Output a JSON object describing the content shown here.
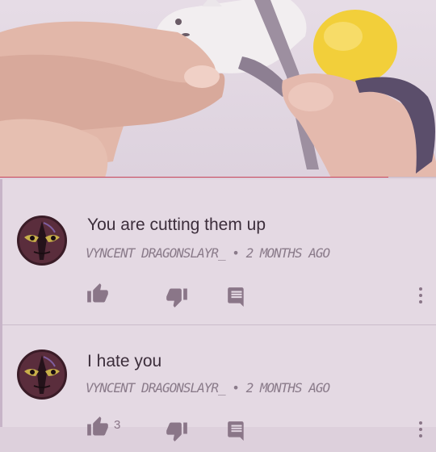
{
  "video": {
    "progress": 0.89,
    "accent_color": "#c8465c"
  },
  "comments": [
    {
      "text": "You are cutting them up",
      "author": "VYNCENT DRAGONSLAYR_",
      "separator": "•",
      "time": "2 MONTHS AGO",
      "like_icon": "thumbs-up-icon",
      "dislike_icon": "thumbs-down-icon",
      "reply_icon": "reply-icon",
      "more_icon": "more-vert-icon"
    },
    {
      "text": "I hate you",
      "author": "VYNCENT DRAGONSLAYR_",
      "separator": "•",
      "time": "2 MONTHS AGO",
      "like_count": "3",
      "like_icon": "thumbs-up-icon",
      "dislike_icon": "thumbs-down-icon",
      "reply_icon": "reply-icon",
      "more_icon": "more-vert-icon"
    }
  ]
}
